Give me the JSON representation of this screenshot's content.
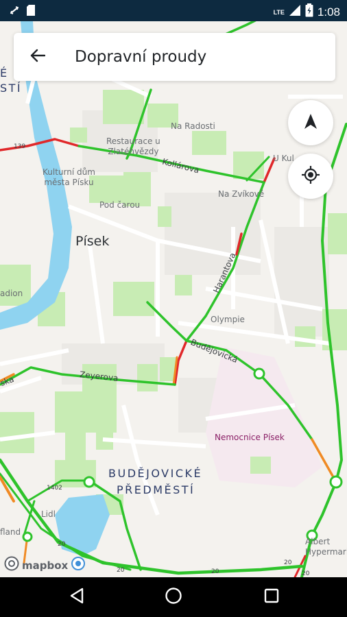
{
  "status_bar": {
    "time": "1:08",
    "network": "LTE"
  },
  "top_bar": {
    "title": "Dopravní proudy"
  },
  "map": {
    "labels": {
      "kulturni_dum": "Kulturní dům\nměsta Písku",
      "pisek": "Písek",
      "na_radosti": "Na Radosti",
      "restaurace": "Restaurace u\nZlatéhvězdy",
      "kollarova": "Kollárova",
      "na_zvikove": "Na Zvíkově",
      "pod_carou": "Pod čarou",
      "haranova": "Harantova",
      "olympie": "Olympie",
      "budejovicka": "Budějovická",
      "zeyerova": "Zeyerova",
      "nemocnice": "Nemocnice Písek",
      "district_1": "BUDĚJOVICKÉ",
      "district_2": "PŘEDMĚSTÍ",
      "lidl": "Lidl",
      "albert": "Albert\nHypermark",
      "u_kul": "U Kul",
      "stadion": "adion",
      "road_139": "139",
      "road_1402": "1402",
      "road_20_a": "20",
      "road_20_b": "20",
      "road_20_c": "20",
      "road_20_d": "20",
      "road_20_e": "20",
      "edge_ska": "ska",
      "edge_land": "fland",
      "edge_e": "É",
      "edge_sti": "STÍ"
    },
    "traffic_colors": {
      "free": "#2ec32b",
      "slow": "#f08a24",
      "heavy": "#e0282a"
    },
    "colors": {
      "park": "#c8ecb4",
      "water": "#8fd3f0",
      "hospital_area": "#f5e8ee",
      "street": "#ffffff",
      "block": "#e8e6e2"
    }
  },
  "attribution": {
    "brand": "mapbox"
  },
  "icons": {
    "back": "arrow-left-icon",
    "compass": "navigation-arrow-icon",
    "locate": "my-location-icon",
    "nav_back": "triangle-back-icon",
    "nav_home": "circle-home-icon",
    "nav_recent": "square-recent-icon"
  }
}
